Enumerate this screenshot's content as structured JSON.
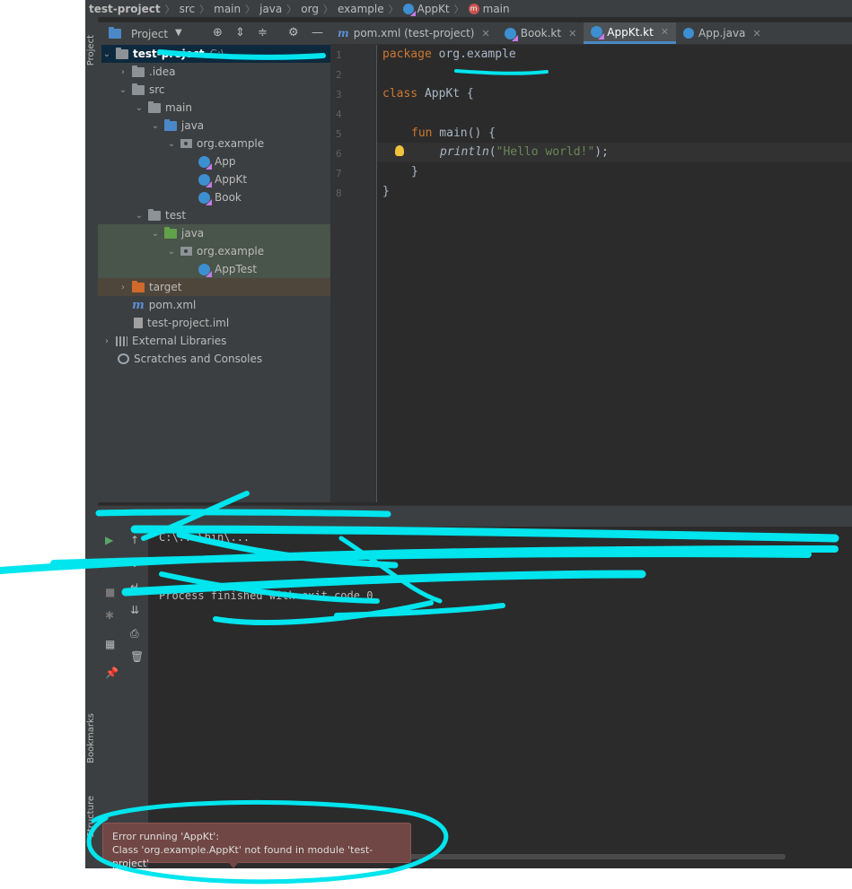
{
  "breadcrumb": [
    "test-project",
    "src",
    "main",
    "java",
    "org",
    "example",
    "AppKt",
    "main"
  ],
  "side_labels": {
    "project": "Project",
    "bookmarks": "Bookmarks",
    "structure": "Structure"
  },
  "project_panel": {
    "title": "Project",
    "tree": [
      {
        "label": "test-project",
        "hint": "C:\\..."
      },
      {
        "label": ".idea"
      },
      {
        "label": "src"
      },
      {
        "label": "main"
      },
      {
        "label": "java"
      },
      {
        "label": "org.example"
      },
      {
        "label": "App"
      },
      {
        "label": "AppKt"
      },
      {
        "label": "Book"
      },
      {
        "label": "test"
      },
      {
        "label": "java"
      },
      {
        "label": "org.example"
      },
      {
        "label": "AppTest"
      },
      {
        "label": "target"
      },
      {
        "label": "pom.xml"
      },
      {
        "label": "test-project.iml"
      },
      {
        "label": "External Libraries"
      },
      {
        "label": "Scratches and Consoles"
      }
    ]
  },
  "tabs": [
    {
      "label": "pom.xml (test-project)"
    },
    {
      "label": "Book.kt"
    },
    {
      "label": "AppKt.kt"
    },
    {
      "label": "App.java"
    }
  ],
  "editor": {
    "line_numbers": [
      "1",
      "2",
      "3",
      "4",
      "5",
      "6",
      "7",
      "8"
    ],
    "lines": {
      "l1_kw": "package",
      "l1_rest": " org.example",
      "l3_kw": "class",
      "l3_rest": " AppKt {",
      "l5_kw": "fun",
      "l5_rest": " main() {",
      "l6_fn": "println",
      "l6_open": "(",
      "l6_str": "\"Hello world!\"",
      "l6_close": ");",
      "l7": "}",
      "l8": "}"
    }
  },
  "console": {
    "line1": "C:\\...\\bin\\...",
    "line3": "Process finished with exit code 0"
  },
  "error_balloon": {
    "title": "Error running 'AppKt':",
    "message": "Class 'org.example.AppKt' not found in module 'test-project'"
  },
  "colors": {
    "accent": "#4a88c7",
    "error_bg": "#704745",
    "scribble": "#00e5ee"
  }
}
